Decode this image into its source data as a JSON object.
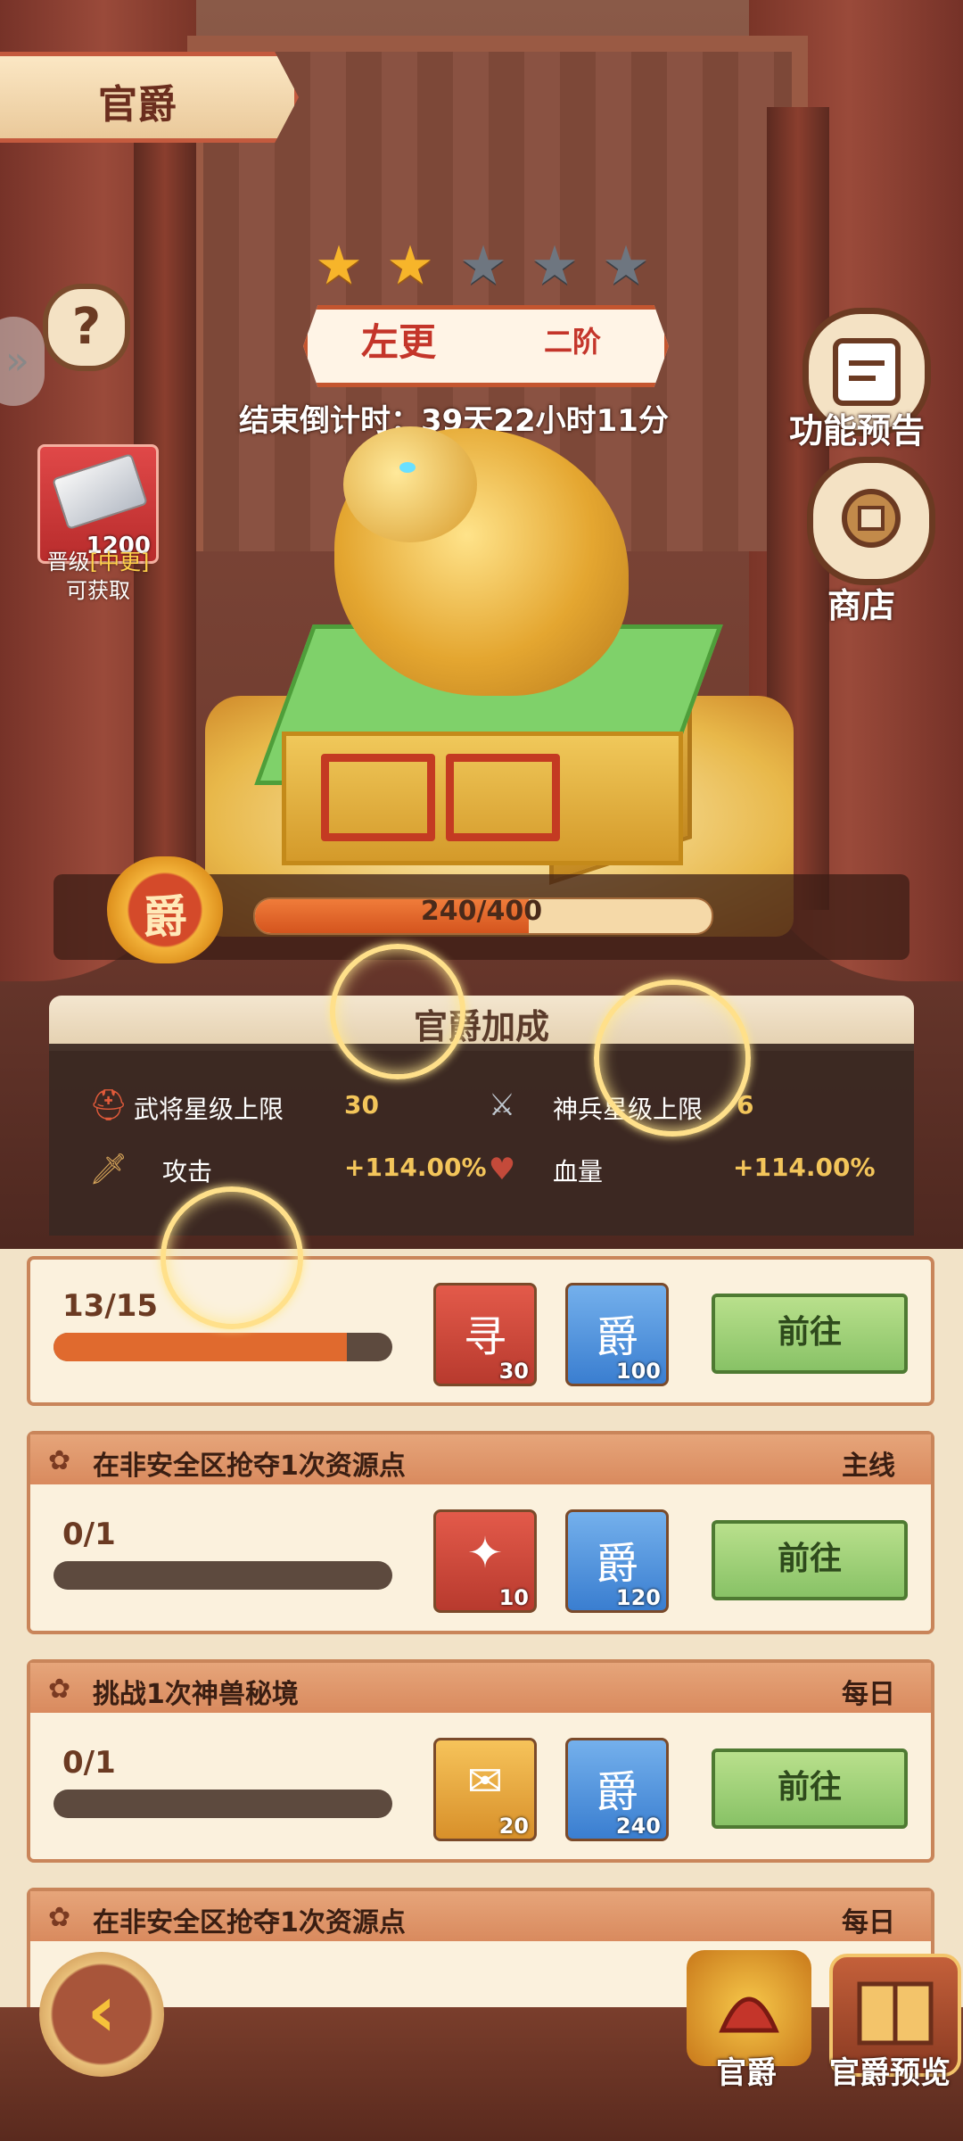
{
  "header": {
    "title": "官爵"
  },
  "rank": {
    "stars_total": 5,
    "stars_lit": 2,
    "name": "左更",
    "tier": "二阶",
    "countdown": "结束倒计时：39天22小时11分"
  },
  "left_reward": {
    "count": "1200",
    "label_prefix": "晋级",
    "label_highlight": "[中更]",
    "label_suffix": "可获取"
  },
  "side_buttons": [
    {
      "label": "功能预告",
      "icon": "scroll-icon"
    },
    {
      "label": "商店",
      "icon": "shop-icon"
    }
  ],
  "progress": {
    "badge": "爵",
    "text": "240/400",
    "current": 240,
    "max": 400
  },
  "bonus": {
    "title": "官爵加成",
    "stats": [
      {
        "label": "武将星级上限",
        "value": "30"
      },
      {
        "label": "神兵星级上限",
        "value": "6"
      },
      {
        "label": "攻击",
        "value": "+114.00%"
      },
      {
        "label": "血量",
        "value": "+114.00%"
      }
    ]
  },
  "tasks": [
    {
      "name": "",
      "type": "",
      "progress": "13/15",
      "fraction": 0.867,
      "rewards": [
        {
          "count": "30",
          "symbol": "寻"
        },
        {
          "count": "100",
          "symbol": "爵"
        }
      ],
      "button": "前往"
    },
    {
      "name": "在非安全区抢夺1次资源点",
      "type": "主线",
      "progress": "0/1",
      "fraction": 0,
      "rewards": [
        {
          "count": "10",
          "symbol": "✦"
        },
        {
          "count": "120",
          "symbol": "爵"
        }
      ],
      "button": "前往"
    },
    {
      "name": "挑战1次神兽秘境",
      "type": "每日",
      "progress": "0/1",
      "fraction": 0,
      "rewards": [
        {
          "count": "20",
          "symbol": "✉"
        },
        {
          "count": "240",
          "symbol": "爵"
        }
      ],
      "button": "前往"
    },
    {
      "name": "在非安全区抢夺1次资源点",
      "type": "每日"
    }
  ],
  "bottom_nav": [
    {
      "label": "官爵"
    },
    {
      "label": "官爵预览"
    }
  ],
  "colors": {
    "accent": "#c4352a",
    "star_on": "#f7b52a",
    "star_off": "#6e7680",
    "go_button": "#88c266"
  }
}
